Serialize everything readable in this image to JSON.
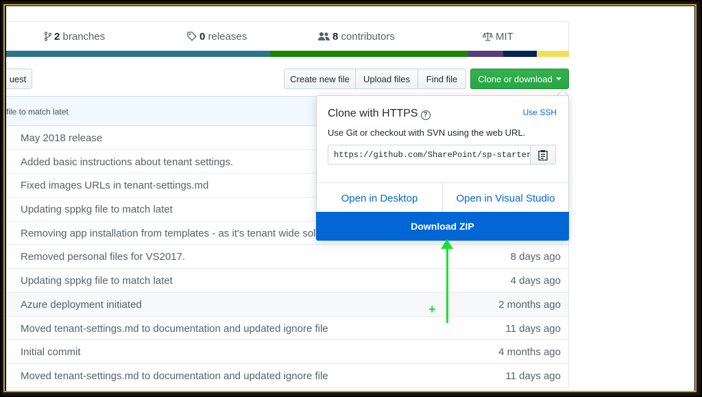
{
  "summary": {
    "branches_count": "2",
    "branches_label": " branches",
    "releases_count": "0",
    "releases_label": " releases",
    "contributors_count": "8",
    "contributors_label": " contributors",
    "license": "MIT"
  },
  "language_bar": [
    "#2b7489",
    "#178600",
    "#563d7c",
    "#012456",
    "#f1e05a"
  ],
  "toolbar": {
    "pull_request": "uest",
    "create_new_file": "Create new file",
    "upload_files": "Upload files",
    "find_file": "Find file",
    "clone_or_download": "Clone or download"
  },
  "latest_commit": "file to match latet",
  "files": [
    {
      "message": "May 2018 release",
      "age": ""
    },
    {
      "message": "Added basic instructions about tenant settings.",
      "age": ""
    },
    {
      "message": "Fixed images URLs in tenant-settings.md",
      "age": ""
    },
    {
      "message": "Updating sppkg file to match latet",
      "age": ""
    },
    {
      "message": "Removing app installation from templates - as it's tenant wide solu",
      "age": ""
    },
    {
      "message": "Removed personal files for VS2017.",
      "age": "8 days ago"
    },
    {
      "message": "Updating sppkg file to match latet",
      "age": "4 days ago"
    },
    {
      "message": "Azure deployment initiated",
      "age": "2 months ago"
    },
    {
      "message": "Moved tenant-settings.md to documentation and updated ignore file",
      "age": "11 days ago"
    },
    {
      "message": "Initial commit",
      "age": "4 months ago"
    },
    {
      "message": "Moved tenant-settings.md to documentation and updated ignore file",
      "age": "11 days ago"
    }
  ],
  "clone_dropdown": {
    "title": "Clone with HTTPS",
    "help_icon": "?",
    "use_ssh": "Use SSH",
    "description": "Use Git or checkout with SVN using the web URL.",
    "url": "https://github.com/SharePoint/sp-starter-kit.git",
    "open_desktop": "Open in Desktop",
    "open_visual_studio": "Open in Visual Studio",
    "download_zip": "Download ZIP"
  },
  "annotation": {
    "color": "#17e32c",
    "plus": "+"
  }
}
